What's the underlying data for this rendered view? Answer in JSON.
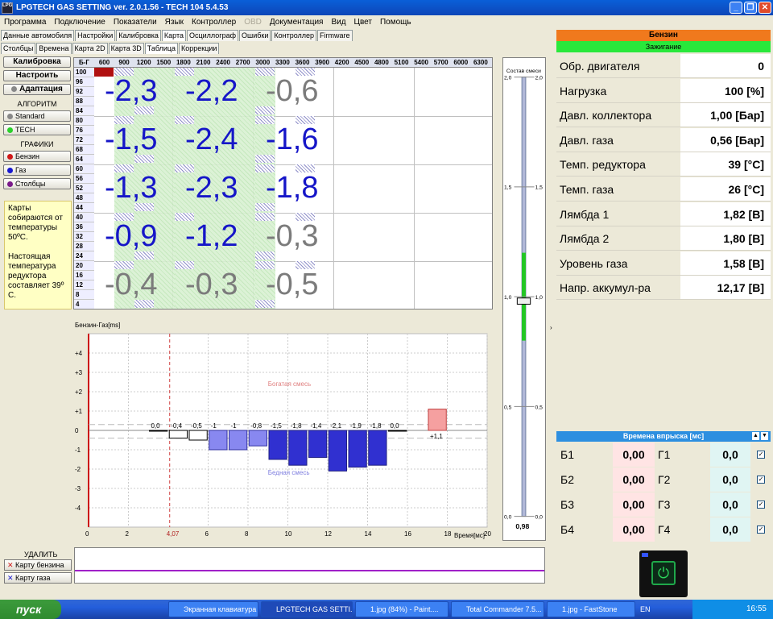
{
  "window": {
    "title": "LPGTECH GAS SETTING ver. 2.0.1.56  -  TECH 104  5.4.53",
    "minimize": "_",
    "restore": "❐",
    "close": "✕"
  },
  "menu": [
    "Программа",
    "Подключение",
    "Показатели",
    "Язык",
    "Контроллер",
    "OBD",
    "Документация",
    "Вид",
    "Цвет",
    "Помощь"
  ],
  "tabs1": [
    "Данные автомобиля",
    "Настройки",
    "Калибровка",
    "Карта",
    "Осциллограф",
    "Ошибки",
    "Контроллер",
    "Firmware"
  ],
  "tabs2": [
    "Столбцы",
    "Времена",
    "Карта 2D",
    "Карта 3D",
    "Таблица",
    "Коррекции"
  ],
  "left": {
    "calib": "Калибровка",
    "setup": "Настроить",
    "adapt": "Адаптация",
    "algo_head": "АЛГОРИТМ",
    "algo": [
      "Standard",
      "TECH"
    ],
    "graphs_head": "ГРАФИКИ",
    "graphs": [
      "Бензин",
      "Газ",
      "Столбцы"
    ],
    "note": "Карты собираются от температуры 50ºC.\n\nНастоящая температура редуктора составляет 39º C."
  },
  "map": {
    "corner": "Б-Г",
    "cols": [
      "600",
      "900",
      "1200",
      "1500",
      "1800",
      "2100",
      "2400",
      "2700",
      "3000",
      "3300",
      "3600",
      "3900",
      "4200",
      "4500",
      "4800",
      "5100",
      "5400",
      "5700",
      "6000",
      "6300"
    ],
    "rows": [
      "100",
      "96",
      "92",
      "88",
      "84",
      "80",
      "76",
      "72",
      "68",
      "64",
      "60",
      "56",
      "52",
      "48",
      "44",
      "40",
      "36",
      "32",
      "28",
      "24",
      "20",
      "16",
      "12",
      "8",
      "4"
    ],
    "values": [
      [
        "-2,3",
        "-2,2",
        "-0,6"
      ],
      [
        "-1,5",
        "-2,4",
        "-1,6"
      ],
      [
        "-1,3",
        "-2,3",
        "-1,8"
      ],
      [
        "-0,9",
        "-1,2",
        "-0,3"
      ],
      [
        "-0,4",
        "-0,3",
        "-0,5"
      ]
    ],
    "value_colors": [
      [
        "#1616c8",
        "#1616c8",
        "#7b7b7b"
      ],
      [
        "#1616c8",
        "#1616c8",
        "#1616c8"
      ],
      [
        "#1616c8",
        "#1616c8",
        "#1616c8"
      ],
      [
        "#1616c8",
        "#1616c8",
        "#7b7b7b"
      ],
      [
        "#7b7b7b",
        "#7b7b7b",
        "#7b7b7b"
      ]
    ]
  },
  "chart_data": {
    "type": "bar",
    "ylabel": "Бензин-Газ[ms]",
    "xlabel": "Время[мс]",
    "xlim": [
      0,
      20
    ],
    "ylim": [
      -5,
      5
    ],
    "xticks": [
      "0",
      "2",
      "4,07",
      "6",
      "8",
      "10",
      "12",
      "14",
      "16",
      "18",
      "20"
    ],
    "yticks": [
      "+4",
      "+3",
      "+2",
      "+1",
      "0",
      "-1",
      "-2",
      "-3",
      "-4"
    ],
    "rich": "Богатая смесь",
    "lean": "Бедная смесь",
    "marker": 4.07,
    "x": [
      3.5,
      4.5,
      5.5,
      6.5,
      7.5,
      8.5,
      9.5,
      10.5,
      11.5,
      12.5,
      13.5,
      14.5,
      15.5,
      17.5
    ],
    "values": [
      0,
      -0.4,
      -0.5,
      -1,
      -1,
      -0.8,
      -1.5,
      -1.8,
      -1.4,
      -2.1,
      -1.9,
      -1.8,
      0,
      1.1
    ],
    "labels": [
      "0,0",
      "-0,4",
      "-0,5",
      "-1",
      "-1",
      "-0,8",
      "-1,5",
      "-1,8",
      "-1,4",
      "-2,1",
      "-1,9",
      "-1,8",
      "0,0",
      "+1,1"
    ]
  },
  "slider": {
    "title": "Состав смеси",
    "ticks": [
      "2,0",
      "1,5",
      "1,0",
      "0,5",
      "0,0"
    ],
    "value": "0,98",
    "level": 0.98
  },
  "fuel": "Бензин",
  "ignition": "Зажигание",
  "params": [
    {
      "label": "Обр. двигателя",
      "value": "0"
    },
    {
      "label": "Нагрузка",
      "value": "100 [%]"
    },
    {
      "label": "Давл. коллектора",
      "value": "1,00 [Бар]"
    },
    {
      "label": "Давл. газа",
      "value": "0,56 [Бар]"
    },
    {
      "label": "Темп. редуктора",
      "value": "39 [°C]"
    },
    {
      "label": "Темп. газа",
      "value": "26 [°C]"
    },
    {
      "label": "Лямбда 1",
      "value": "1,82 [В]"
    },
    {
      "label": "Лямбда 2",
      "value": "1,80 [В]"
    },
    {
      "label": "Уровень газа",
      "value": "1,58 [В]"
    },
    {
      "label": "Напр. аккумул-ра",
      "value": "12,17 [В]"
    }
  ],
  "inj": {
    "title": "Времена впрыска [мс]",
    "rows": [
      {
        "b": "Б1",
        "bv": "0,00",
        "g": "Г1",
        "gv": "0,0"
      },
      {
        "b": "Б2",
        "bv": "0,00",
        "g": "Г2",
        "gv": "0,0"
      },
      {
        "b": "Б3",
        "bv": "0,00",
        "g": "Г3",
        "gv": "0,0"
      },
      {
        "b": "Б4",
        "bv": "0,00",
        "g": "Г4",
        "gv": "0,0"
      }
    ]
  },
  "del": {
    "head": "УДАЛИТЬ",
    "b1": "Карту бензина",
    "b2": "Карту газа"
  },
  "taskbar": {
    "start": "пуск",
    "tasks": [
      "Экранная клавиатура",
      "LPGTECH GAS SETTI...",
      "1.jpg (84%) - Paint....",
      "Total Commander 7.5...",
      "1.jpg - FastStone"
    ],
    "lang": "EN",
    "clock": "16:55"
  }
}
